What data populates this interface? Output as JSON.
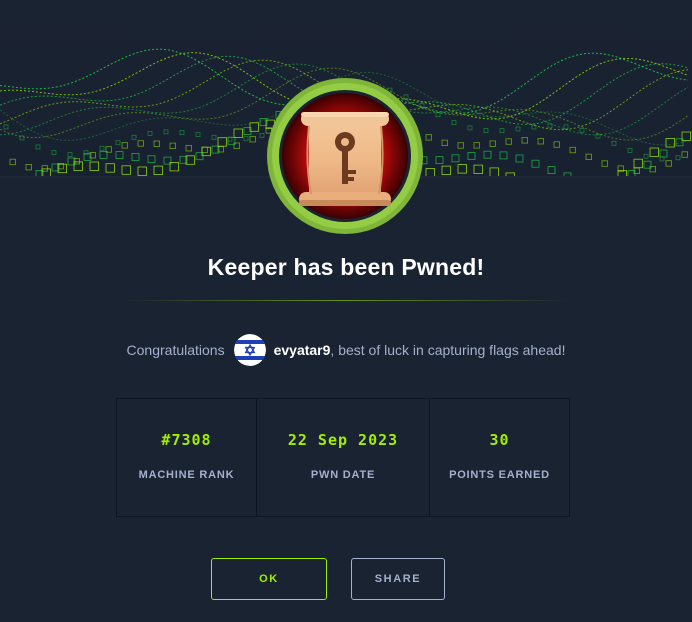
{
  "banner": {
    "accent": "#9fef00",
    "glow": "#22d44a"
  },
  "badge": {
    "icon": "scroll-key-icon",
    "ring_color": "#8ec63f"
  },
  "title": "Keeper has been Pwned!",
  "congrats": {
    "prefix": "Congratulations",
    "username": "evyatar9",
    "suffix": ", best of luck in capturing flags ahead!",
    "avatar_icon": "israel-flag-icon"
  },
  "stats": [
    {
      "value": "#7308",
      "label": "MACHINE RANK"
    },
    {
      "value": "22 Sep 2023",
      "label": "PWN DATE"
    },
    {
      "value": "30",
      "label": "POINTS EARNED"
    }
  ],
  "buttons": {
    "ok": "OK",
    "share": "SHARE"
  }
}
